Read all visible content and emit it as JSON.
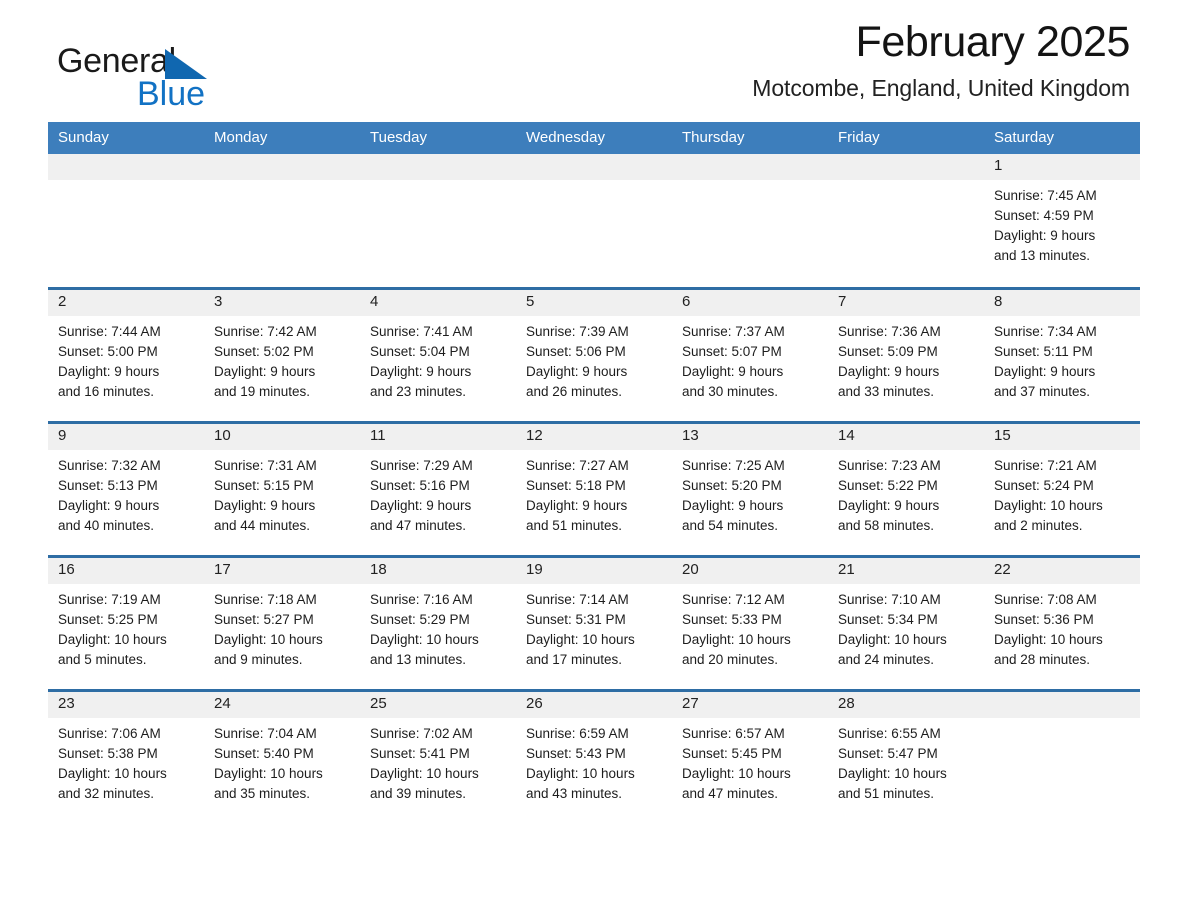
{
  "logo": {
    "word_one": "General",
    "word_two": "Blue",
    "triangle_color": "#1067b0",
    "blue_color": "#1272c4"
  },
  "header": {
    "title": "February 2025",
    "location": "Motcombe, England, United Kingdom"
  },
  "colors": {
    "header_row_bg": "#3d7ebc",
    "row_separator": "#2e6da4",
    "date_band_bg": "#f0f0f0",
    "page_bg": "#ffffff",
    "text": "#1d1d1d"
  },
  "weekdays": [
    "Sunday",
    "Monday",
    "Tuesday",
    "Wednesday",
    "Thursday",
    "Friday",
    "Saturday"
  ],
  "labels": {
    "sunrise_prefix": "Sunrise:",
    "sunset_prefix": "Sunset:",
    "daylight_prefix": "Daylight:"
  },
  "weeks": [
    [
      {
        "date": "",
        "lines": []
      },
      {
        "date": "",
        "lines": []
      },
      {
        "date": "",
        "lines": []
      },
      {
        "date": "",
        "lines": []
      },
      {
        "date": "",
        "lines": []
      },
      {
        "date": "",
        "lines": []
      },
      {
        "date": "1",
        "lines": [
          "Sunrise: 7:45 AM",
          "Sunset: 4:59 PM",
          "Daylight: 9 hours",
          "and 13 minutes."
        ]
      }
    ],
    [
      {
        "date": "2",
        "lines": [
          "Sunrise: 7:44 AM",
          "Sunset: 5:00 PM",
          "Daylight: 9 hours",
          "and 16 minutes."
        ]
      },
      {
        "date": "3",
        "lines": [
          "Sunrise: 7:42 AM",
          "Sunset: 5:02 PM",
          "Daylight: 9 hours",
          "and 19 minutes."
        ]
      },
      {
        "date": "4",
        "lines": [
          "Sunrise: 7:41 AM",
          "Sunset: 5:04 PM",
          "Daylight: 9 hours",
          "and 23 minutes."
        ]
      },
      {
        "date": "5",
        "lines": [
          "Sunrise: 7:39 AM",
          "Sunset: 5:06 PM",
          "Daylight: 9 hours",
          "and 26 minutes."
        ]
      },
      {
        "date": "6",
        "lines": [
          "Sunrise: 7:37 AM",
          "Sunset: 5:07 PM",
          "Daylight: 9 hours",
          "and 30 minutes."
        ]
      },
      {
        "date": "7",
        "lines": [
          "Sunrise: 7:36 AM",
          "Sunset: 5:09 PM",
          "Daylight: 9 hours",
          "and 33 minutes."
        ]
      },
      {
        "date": "8",
        "lines": [
          "Sunrise: 7:34 AM",
          "Sunset: 5:11 PM",
          "Daylight: 9 hours",
          "and 37 minutes."
        ]
      }
    ],
    [
      {
        "date": "9",
        "lines": [
          "Sunrise: 7:32 AM",
          "Sunset: 5:13 PM",
          "Daylight: 9 hours",
          "and 40 minutes."
        ]
      },
      {
        "date": "10",
        "lines": [
          "Sunrise: 7:31 AM",
          "Sunset: 5:15 PM",
          "Daylight: 9 hours",
          "and 44 minutes."
        ]
      },
      {
        "date": "11",
        "lines": [
          "Sunrise: 7:29 AM",
          "Sunset: 5:16 PM",
          "Daylight: 9 hours",
          "and 47 minutes."
        ]
      },
      {
        "date": "12",
        "lines": [
          "Sunrise: 7:27 AM",
          "Sunset: 5:18 PM",
          "Daylight: 9 hours",
          "and 51 minutes."
        ]
      },
      {
        "date": "13",
        "lines": [
          "Sunrise: 7:25 AM",
          "Sunset: 5:20 PM",
          "Daylight: 9 hours",
          "and 54 minutes."
        ]
      },
      {
        "date": "14",
        "lines": [
          "Sunrise: 7:23 AM",
          "Sunset: 5:22 PM",
          "Daylight: 9 hours",
          "and 58 minutes."
        ]
      },
      {
        "date": "15",
        "lines": [
          "Sunrise: 7:21 AM",
          "Sunset: 5:24 PM",
          "Daylight: 10 hours",
          "and 2 minutes."
        ]
      }
    ],
    [
      {
        "date": "16",
        "lines": [
          "Sunrise: 7:19 AM",
          "Sunset: 5:25 PM",
          "Daylight: 10 hours",
          "and 5 minutes."
        ]
      },
      {
        "date": "17",
        "lines": [
          "Sunrise: 7:18 AM",
          "Sunset: 5:27 PM",
          "Daylight: 10 hours",
          "and 9 minutes."
        ]
      },
      {
        "date": "18",
        "lines": [
          "Sunrise: 7:16 AM",
          "Sunset: 5:29 PM",
          "Daylight: 10 hours",
          "and 13 minutes."
        ]
      },
      {
        "date": "19",
        "lines": [
          "Sunrise: 7:14 AM",
          "Sunset: 5:31 PM",
          "Daylight: 10 hours",
          "and 17 minutes."
        ]
      },
      {
        "date": "20",
        "lines": [
          "Sunrise: 7:12 AM",
          "Sunset: 5:33 PM",
          "Daylight: 10 hours",
          "and 20 minutes."
        ]
      },
      {
        "date": "21",
        "lines": [
          "Sunrise: 7:10 AM",
          "Sunset: 5:34 PM",
          "Daylight: 10 hours",
          "and 24 minutes."
        ]
      },
      {
        "date": "22",
        "lines": [
          "Sunrise: 7:08 AM",
          "Sunset: 5:36 PM",
          "Daylight: 10 hours",
          "and 28 minutes."
        ]
      }
    ],
    [
      {
        "date": "23",
        "lines": [
          "Sunrise: 7:06 AM",
          "Sunset: 5:38 PM",
          "Daylight: 10 hours",
          "and 32 minutes."
        ]
      },
      {
        "date": "24",
        "lines": [
          "Sunrise: 7:04 AM",
          "Sunset: 5:40 PM",
          "Daylight: 10 hours",
          "and 35 minutes."
        ]
      },
      {
        "date": "25",
        "lines": [
          "Sunrise: 7:02 AM",
          "Sunset: 5:41 PM",
          "Daylight: 10 hours",
          "and 39 minutes."
        ]
      },
      {
        "date": "26",
        "lines": [
          "Sunrise: 6:59 AM",
          "Sunset: 5:43 PM",
          "Daylight: 10 hours",
          "and 43 minutes."
        ]
      },
      {
        "date": "27",
        "lines": [
          "Sunrise: 6:57 AM",
          "Sunset: 5:45 PM",
          "Daylight: 10 hours",
          "and 47 minutes."
        ]
      },
      {
        "date": "28",
        "lines": [
          "Sunrise: 6:55 AM",
          "Sunset: 5:47 PM",
          "Daylight: 10 hours",
          "and 51 minutes."
        ]
      },
      {
        "date": "",
        "lines": []
      }
    ]
  ]
}
